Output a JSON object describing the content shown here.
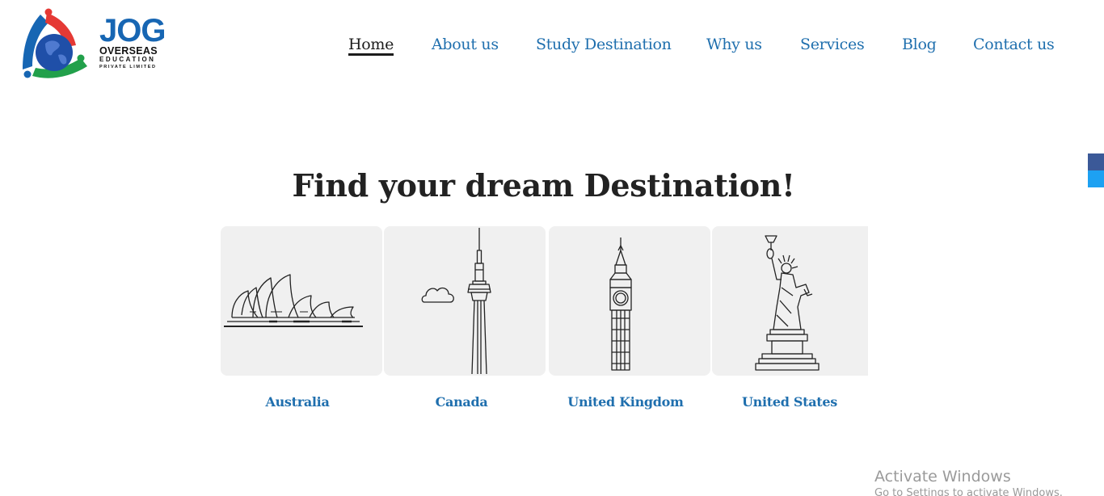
{
  "brand": {
    "logo_word": "JOG",
    "logo_line1": "OVERSEAS",
    "logo_line2": "EDUCATION",
    "logo_line3": "PRIVATE LIMITED"
  },
  "nav": {
    "items": [
      {
        "label": "Home",
        "active": true
      },
      {
        "label": "About us"
      },
      {
        "label": "Study Destination"
      },
      {
        "label": "Why us"
      },
      {
        "label": "Services"
      },
      {
        "label": "Blog"
      },
      {
        "label": "Contact us"
      }
    ]
  },
  "main": {
    "title": "Find your dream Destination!",
    "destinations": [
      {
        "label": "Australia",
        "icon": "sydney-opera-house-icon"
      },
      {
        "label": "Canada",
        "icon": "cn-tower-icon"
      },
      {
        "label": "United Kingdom",
        "icon": "big-ben-icon"
      },
      {
        "label": "United States",
        "icon": "statue-of-liberty-icon"
      }
    ]
  },
  "watermark": {
    "line1": "Activate Windows",
    "line2": "Go to Settings to activate Windows."
  },
  "colors": {
    "link": "#1f6fae",
    "brand_blue": "#1766b3",
    "card_bg": "#f0f0f0",
    "logo_red": "#e53935",
    "logo_green": "#22a04b"
  }
}
